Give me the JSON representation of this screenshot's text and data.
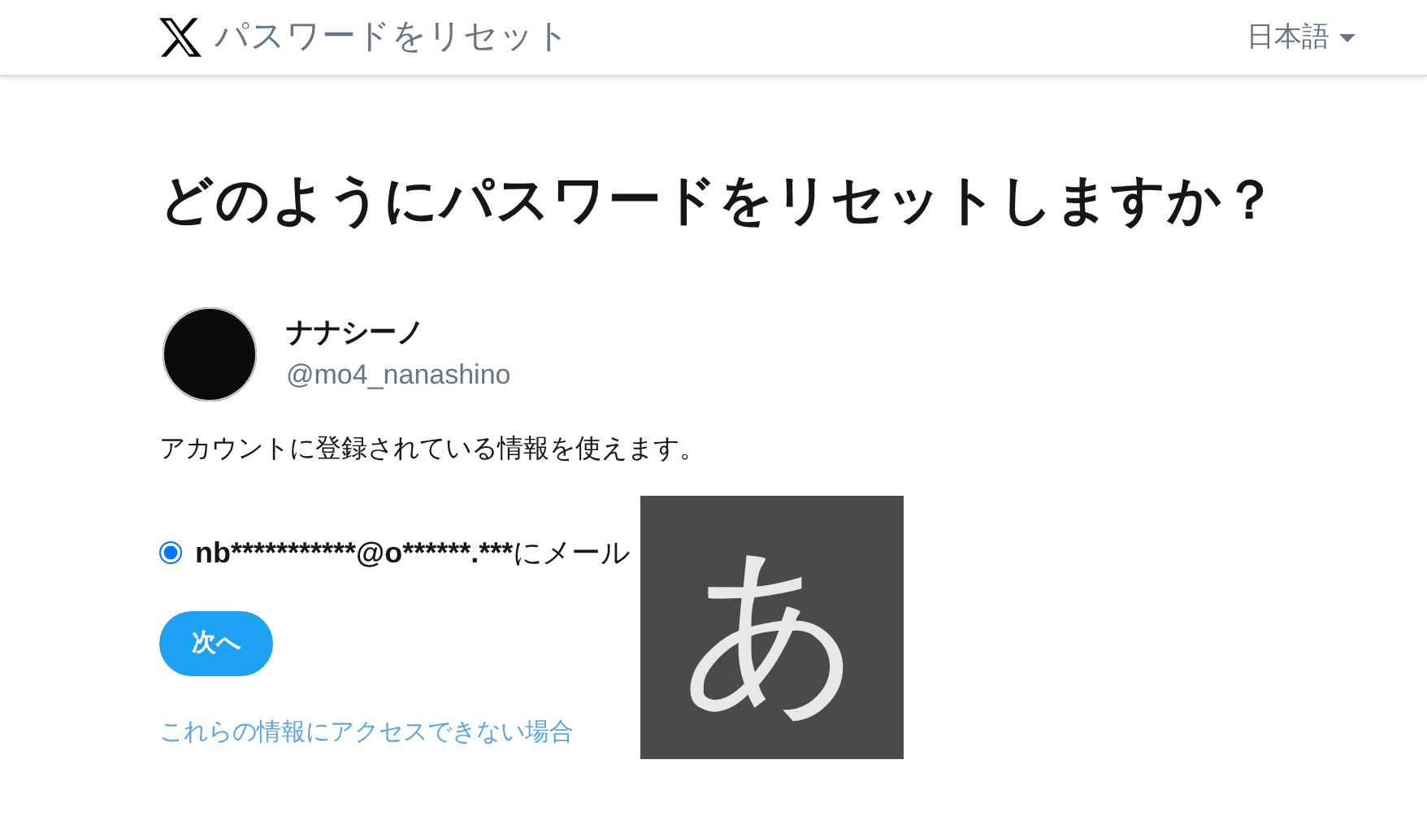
{
  "header": {
    "title": "パスワードをリセット",
    "language": "日本語"
  },
  "heading": "どのようにパスワードをリセットしますか？",
  "account": {
    "name": "ナナシーノ",
    "handle": "@mo4_nanashino"
  },
  "description": "アカウントに登録されている情報を使えます。",
  "options": [
    {
      "address": "nb***********@o******.***",
      "suffix": "にメール",
      "selected": true
    }
  ],
  "next_button": "次へ",
  "help_link": "これらの情報にアクセスできない場合",
  "ime_indicator": "あ"
}
